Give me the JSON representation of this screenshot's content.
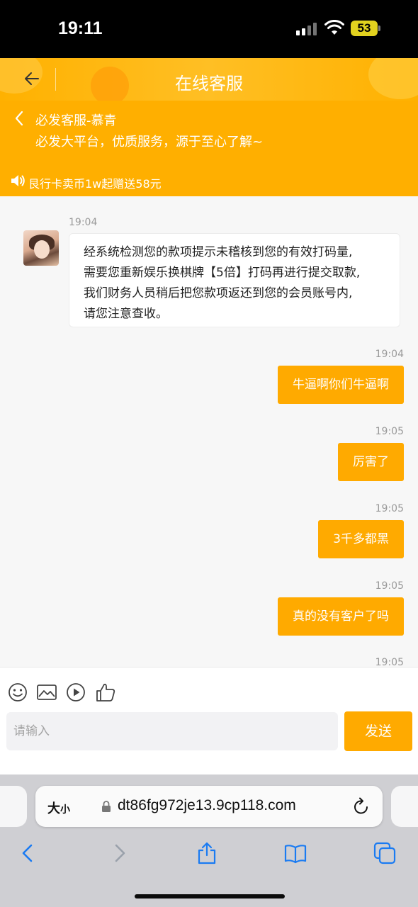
{
  "status_bar": {
    "time": "19:11",
    "battery": "53"
  },
  "header": {
    "title": "在线客服"
  },
  "agent": {
    "name": "必发客服-慕青",
    "slogan": "必发大平台，优质服务，源于至心了解~",
    "notice": "艮行卡卖币1w起赠送58元"
  },
  "messages": {
    "incoming": {
      "time": "19:04",
      "lines": [
        "经系统检测您的款项提示未稽核到您的有效打码量,",
        "需要您重新娱乐换棋牌【5倍】打码再进行提交取款,",
        "我们财务人员稍后把您款项返还到您的会员账号内,",
        "请您注意查收。"
      ]
    },
    "outgoing": [
      {
        "time": "19:04",
        "text": "牛逼啊你们牛逼啊"
      },
      {
        "time": "19:05",
        "text": "厉害了"
      },
      {
        "time": "19:05",
        "text": "3千多都黑"
      },
      {
        "time": "19:05",
        "text": "真的没有客户了吗"
      }
    ],
    "trailing_time": "19:05"
  },
  "composer": {
    "placeholder": "请输入",
    "value": "",
    "send_label": "发送",
    "tools": [
      "emoji-icon",
      "image-icon",
      "video-icon",
      "thumbs-up-icon"
    ]
  },
  "browser": {
    "text_size_label_a": "大",
    "text_size_label_b": "小",
    "url": "dt86fg972je13.9cp118.com",
    "toolbar": [
      "back-icon",
      "forward-icon",
      "share-icon",
      "bookmarks-icon",
      "tabs-icon"
    ]
  },
  "colors": {
    "accent": "#ffaa00",
    "agent_bar": "#ffaf00",
    "ios_blue": "#1a7bf2"
  }
}
